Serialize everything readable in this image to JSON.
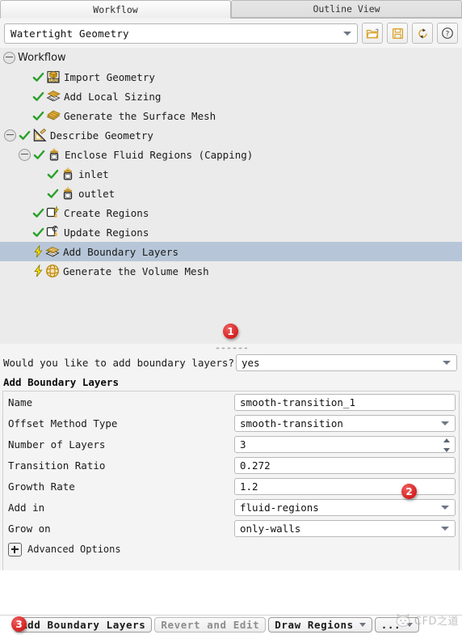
{
  "tabs": [
    {
      "label": "Workflow",
      "active": true
    },
    {
      "label": "Outline View",
      "active": false
    }
  ],
  "toolbar": {
    "workflow_type": "Watertight Geometry",
    "buttons": [
      {
        "name": "open-workflow-icon",
        "title": "Open"
      },
      {
        "name": "save-workflow-icon",
        "title": "Save"
      },
      {
        "name": "reset-workflow-icon",
        "title": "Reset"
      },
      {
        "name": "help-icon",
        "title": "Help"
      }
    ]
  },
  "tree": {
    "root": "Workflow",
    "nodes": [
      {
        "label": "Import Geometry",
        "indent": 2,
        "state": "done",
        "icon": "cad-box-icon",
        "expander": "none"
      },
      {
        "label": "Add Local Sizing",
        "indent": 2,
        "state": "done",
        "icon": "local-sizing-icon",
        "expander": "none"
      },
      {
        "label": "Generate the Surface Mesh",
        "indent": 2,
        "state": "done",
        "icon": "surface-mesh-icon",
        "expander": "none"
      },
      {
        "label": "Describe Geometry",
        "indent": 1,
        "state": "done",
        "icon": "describe-geometry-icon",
        "expander": "collapse"
      },
      {
        "label": "Enclose Fluid Regions (Capping)",
        "indent": 2,
        "state": "done",
        "icon": "capping-icon",
        "expander": "collapse"
      },
      {
        "label": "inlet",
        "indent": 3,
        "state": "done",
        "icon": "capping-icon",
        "expander": "none"
      },
      {
        "label": "outlet",
        "indent": 3,
        "state": "done",
        "icon": "capping-icon",
        "expander": "none"
      },
      {
        "label": "Create Regions",
        "indent": 2,
        "state": "done",
        "icon": "create-regions-icon",
        "expander": "none"
      },
      {
        "label": "Update Regions",
        "indent": 2,
        "state": "done",
        "icon": "update-regions-icon",
        "expander": "none"
      },
      {
        "label": "Add Boundary Layers",
        "indent": 2,
        "state": "pending",
        "icon": "boundary-layers-icon",
        "expander": "none",
        "selected": true
      },
      {
        "label": "Generate the Volume Mesh",
        "indent": 2,
        "state": "pending",
        "icon": "volume-mesh-icon",
        "expander": "none"
      }
    ]
  },
  "question": {
    "label": "Would you like to add boundary layers?",
    "value": "yes"
  },
  "section_title": "Add Boundary Layers",
  "fields": [
    {
      "label": "Name",
      "value": "smooth-transition_1",
      "kind": "text"
    },
    {
      "label": "Offset Method Type",
      "value": "smooth-transition",
      "kind": "combo"
    },
    {
      "label": "Number of Layers",
      "value": "3",
      "kind": "spin"
    },
    {
      "label": "Transition Ratio",
      "value": "0.272",
      "kind": "text"
    },
    {
      "label": "Growth Rate",
      "value": "1.2",
      "kind": "text"
    },
    {
      "label": "Add in",
      "value": "fluid-regions",
      "kind": "combo"
    },
    {
      "label": "Grow on",
      "value": "only-walls",
      "kind": "combo"
    }
  ],
  "advanced_options": {
    "label": "Advanced Options",
    "expanded": false
  },
  "buttons": [
    {
      "label": "Add Boundary Layers",
      "kind": "primary",
      "disabled": false
    },
    {
      "label": "Revert and Edit",
      "kind": "normal",
      "disabled": true
    },
    {
      "label": "Draw Regions",
      "kind": "dropdown",
      "disabled": false
    },
    {
      "label": "...",
      "kind": "dropdown",
      "disabled": false
    }
  ],
  "annotations": [
    {
      "number": "1",
      "target": "tree-node-add-boundary-layers"
    },
    {
      "number": "2",
      "target": "transition-ratio-field"
    },
    {
      "number": "3",
      "target": "add-boundary-layers-button"
    }
  ],
  "watermark": {
    "text": "CFD之道"
  },
  "colors": {
    "selection": "#b6c6d8",
    "tree_bg": "#ebebeb",
    "panel_bg": "#f4f4f4",
    "badge": "#d42020",
    "check": "#2aa02a",
    "bolt": "#f2d000",
    "icon_gold": "#e0a020"
  }
}
